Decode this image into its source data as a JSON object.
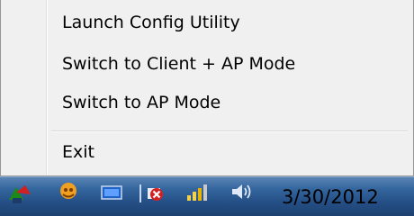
{
  "context_menu": {
    "items": [
      {
        "label": "Launch Config Utility"
      },
      {
        "label": "Switch to Client + AP Mode"
      },
      {
        "label": "Switch to AP Mode"
      },
      {
        "label": "Exit"
      }
    ]
  },
  "taskbar": {
    "tray_icons": [
      "network-icon",
      "security-app-icon",
      "display-icon",
      "no-connection-icon",
      "wireless-utility-icon",
      "speaker-icon"
    ],
    "clock_date": "3/30/2012"
  }
}
